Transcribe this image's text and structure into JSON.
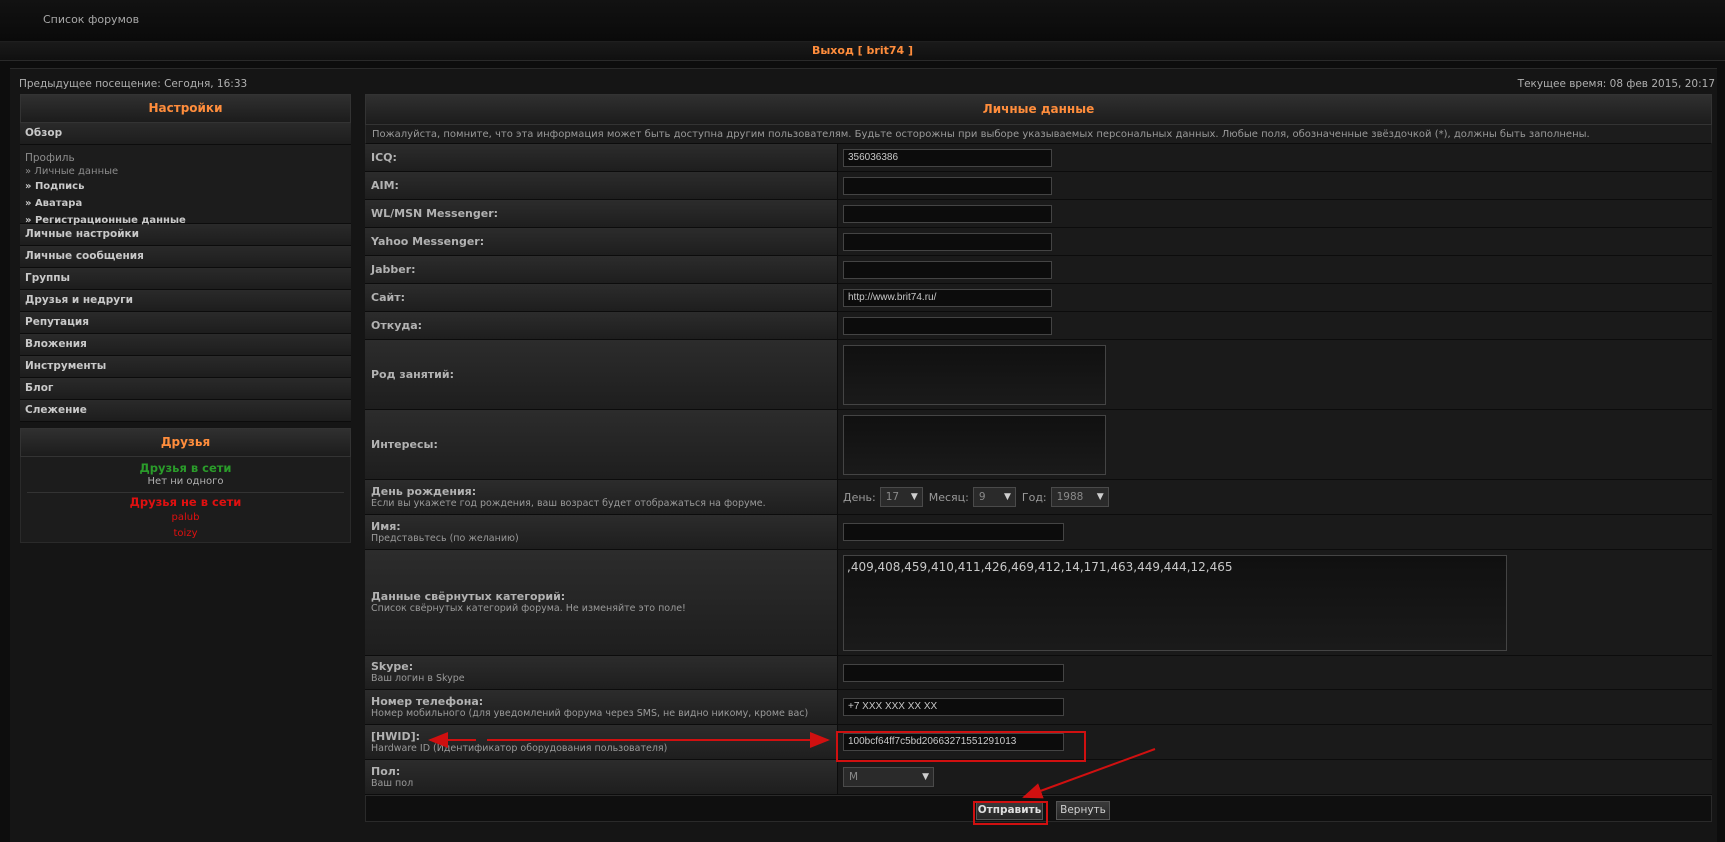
{
  "header": {
    "forum_list": "Список форумов",
    "logout": "Выход [ brit74 ]"
  },
  "info": {
    "previous_visit": "Предыдущее посещение: Сегодня, 16:33",
    "current_time": "Текущее время: 08 фев 2015, 20:17"
  },
  "sidebar": {
    "title": "Настройки",
    "overview": "Обзор",
    "profile": {
      "title": "Профиль",
      "items": [
        "» Личные данные",
        "» Подпись",
        "» Аватара",
        "» Регистрационные данные"
      ]
    },
    "items": [
      "Личные настройки",
      "Личные сообщения",
      "Группы",
      "Друзья и недруги",
      "Репутация",
      "Вложения",
      "Инструменты",
      "Блог",
      "Слежение"
    ]
  },
  "friends": {
    "title": "Друзья",
    "online_title": "Друзья в сети",
    "online_none": "Нет ни одного",
    "offline_title": "Друзья не в сети",
    "offline": [
      "palub",
      "toizy"
    ]
  },
  "form": {
    "title": "Личные данные",
    "notice": "Пожалуйста, помните, что эта информация может быть доступна другим пользователям. Будьте осторожны при выборе указываемых персональных данных. Любые поля, обозначенные звёздочкой (*), должны быть заполнены.",
    "icq": {
      "label": "ICQ:",
      "value": "356036386"
    },
    "aim": {
      "label": "AIM:",
      "value": ""
    },
    "msn": {
      "label": "WL/MSN Messenger:",
      "value": ""
    },
    "yahoo": {
      "label": "Yahoo Messenger:",
      "value": ""
    },
    "jabber": {
      "label": "Jabber:",
      "value": ""
    },
    "site": {
      "label": "Сайт:",
      "value": "http://www.brit74.ru/"
    },
    "from": {
      "label": "Откуда:",
      "value": ""
    },
    "occupation": {
      "label": "Род занятий:",
      "value": ""
    },
    "interests": {
      "label": "Интересы:",
      "value": ""
    },
    "birthday": {
      "label": "День рождения:",
      "desc": "Если вы укажете год рождения, ваш возраст будет отображаться на форуме.",
      "day_label": "День:",
      "day": "17",
      "month_label": "Месяц:",
      "month": "9",
      "year_label": "Год:",
      "year": "1988"
    },
    "name": {
      "label": "Имя:",
      "desc": "Представьтесь (по желанию)",
      "value": ""
    },
    "collapsed": {
      "label": "Данные свёрнутых категорий:",
      "desc": "Список свёрнутых категорий форума. Не изменяйте это поле!",
      "value": ",409,408,459,410,411,426,469,412,14,171,463,449,444,12,465"
    },
    "skype": {
      "label": "Skype:",
      "desc": "Ваш логин в Skype",
      "value": ""
    },
    "phone": {
      "label": "Номер телефона:",
      "desc": "Номер мобильного (для уведомлений форума через SMS, не видно никому, кроме вас)",
      "value": "+7 XXX XXX XX XX"
    },
    "hwid": {
      "label": "[HWID]:",
      "desc": "Hardware ID (Идентификатор оборудования пользователя)",
      "value": "100bcf64ff7c5bd20663271551291013"
    },
    "gender": {
      "label": "Пол:",
      "desc": "Ваш пол",
      "value": "М"
    },
    "submit": "Отправить",
    "reset": "Вернуть"
  },
  "colors": {
    "accent": "#ff8d3c",
    "online": "#2a9c2a",
    "offline": "#e01010",
    "annotation": "#d01010"
  }
}
